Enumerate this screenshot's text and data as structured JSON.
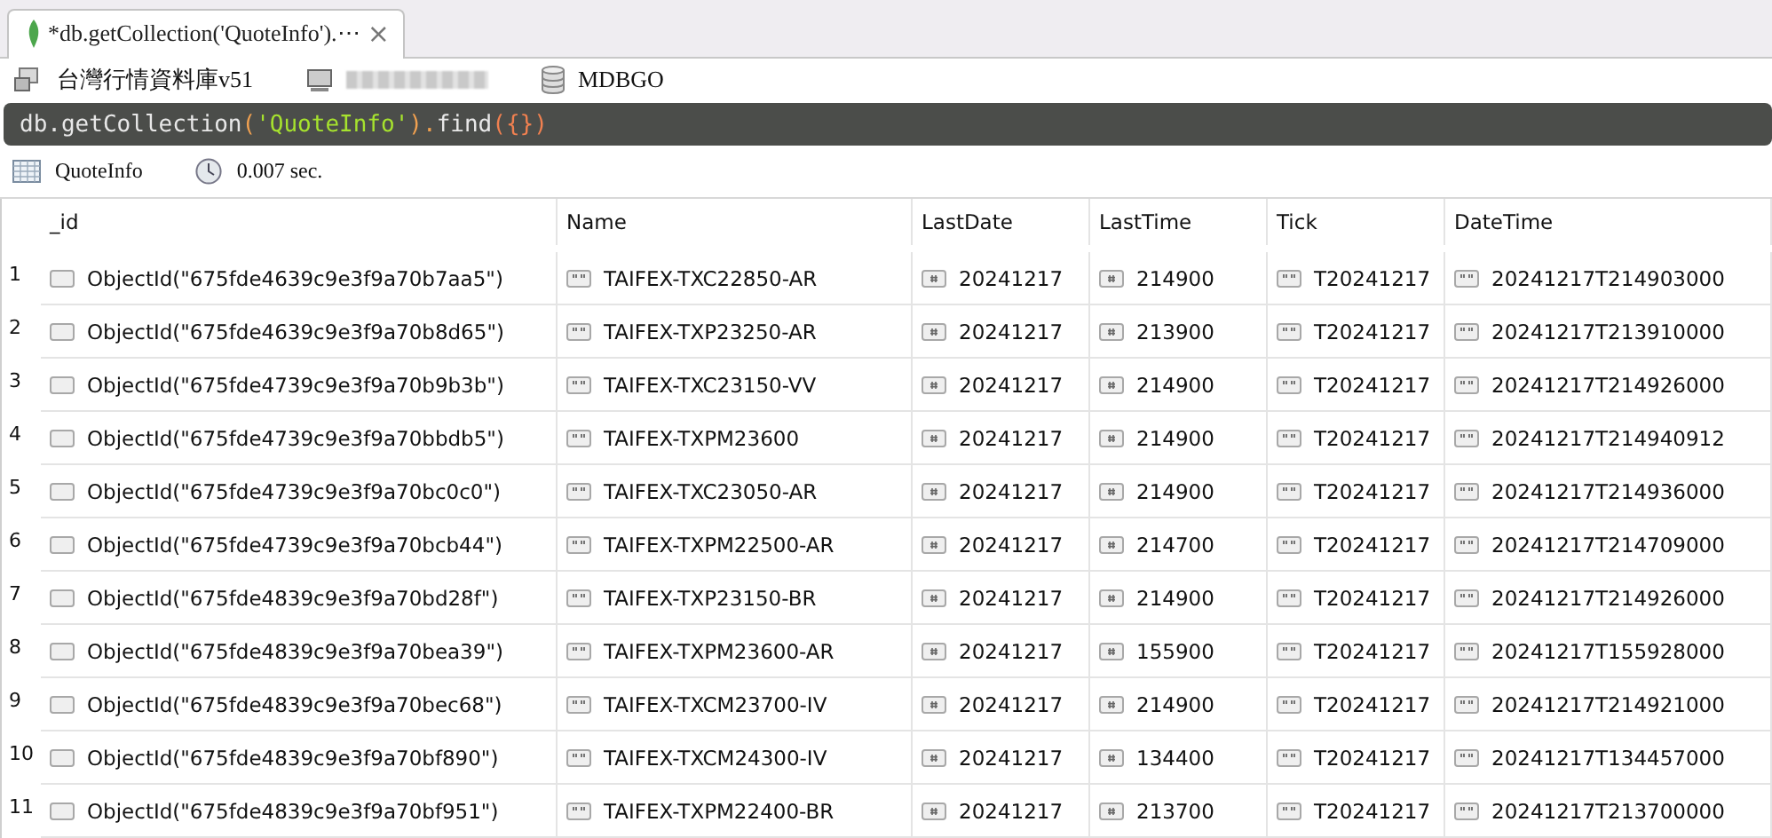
{
  "tab": {
    "title": "*db.getCollection('QuoteInfo').⋯",
    "close": "×",
    "selected": true
  },
  "connection": {
    "database": "台灣行情資料庫v51",
    "database_name": "MDBGO"
  },
  "query": {
    "tokens": [
      {
        "text": "db",
        "color": "#e8e8e8"
      },
      {
        "text": ".getCollection",
        "color": "#e8e8e8"
      },
      {
        "text": "(",
        "color": "#f0a050"
      },
      {
        "text": "'QuoteInfo'",
        "color": "#a6e22e"
      },
      {
        "text": ").",
        "color": "#f0a050"
      },
      {
        "text": "find",
        "color": "#e8e8e8"
      },
      {
        "text": "({})",
        "color": "#f08050"
      }
    ]
  },
  "result": {
    "collection": "QuoteInfo",
    "time": "0.007 sec."
  },
  "table": {
    "columns": [
      {
        "label": "_id",
        "kind": "objectid"
      },
      {
        "label": "Name",
        "kind": "string"
      },
      {
        "label": "LastDate",
        "kind": "number"
      },
      {
        "label": "LastTime",
        "kind": "number"
      },
      {
        "label": "Tick",
        "kind": "string"
      },
      {
        "label": "DateTime",
        "kind": "string"
      }
    ],
    "rows": [
      {
        "index": "1",
        "cells": [
          "ObjectId(\"675fde4639c9e3f9a70b7aa5\")",
          "TAIFEX-TXC22850-AR",
          "20241217",
          "214900",
          "T20241217",
          "20241217T214903000"
        ]
      },
      {
        "index": "2",
        "cells": [
          "ObjectId(\"675fde4639c9e3f9a70b8d65\")",
          "TAIFEX-TXP23250-AR",
          "20241217",
          "213900",
          "T20241217",
          "20241217T213910000"
        ]
      },
      {
        "index": "3",
        "cells": [
          "ObjectId(\"675fde4739c9e3f9a70b9b3b\")",
          "TAIFEX-TXC23150-VV",
          "20241217",
          "214900",
          "T20241217",
          "20241217T214926000"
        ]
      },
      {
        "index": "4",
        "cells": [
          "ObjectId(\"675fde4739c9e3f9a70bbdb5\")",
          "TAIFEX-TXPM23600",
          "20241217",
          "214900",
          "T20241217",
          "20241217T214940912"
        ]
      },
      {
        "index": "5",
        "cells": [
          "ObjectId(\"675fde4739c9e3f9a70bc0c0\")",
          "TAIFEX-TXC23050-AR",
          "20241217",
          "214900",
          "T20241217",
          "20241217T214936000"
        ]
      },
      {
        "index": "6",
        "cells": [
          "ObjectId(\"675fde4739c9e3f9a70bcb44\")",
          "TAIFEX-TXPM22500-AR",
          "20241217",
          "214700",
          "T20241217",
          "20241217T214709000"
        ]
      },
      {
        "index": "7",
        "cells": [
          "ObjectId(\"675fde4839c9e3f9a70bd28f\")",
          "TAIFEX-TXP23150-BR",
          "20241217",
          "214900",
          "T20241217",
          "20241217T214926000"
        ]
      },
      {
        "index": "8",
        "cells": [
          "ObjectId(\"675fde4839c9e3f9a70bea39\")",
          "TAIFEX-TXPM23600-AR",
          "20241217",
          "155900",
          "T20241217",
          "20241217T155928000"
        ]
      },
      {
        "index": "9",
        "cells": [
          "ObjectId(\"675fde4839c9e3f9a70bec68\")",
          "TAIFEX-TXCM23700-IV",
          "20241217",
          "214900",
          "T20241217",
          "20241217T214921000"
        ]
      },
      {
        "index": "10",
        "cells": [
          "ObjectId(\"675fde4839c9e3f9a70bf890\")",
          "TAIFEX-TXCM24300-IV",
          "20241217",
          "134400",
          "T20241217",
          "20241217T134457000"
        ]
      },
      {
        "index": "11",
        "cells": [
          "ObjectId(\"675fde4839c9e3f9a70bf951\")",
          "TAIFEX-TXPM22400-BR",
          "20241217",
          "213700",
          "T20241217",
          "20241217T213700000"
        ]
      }
    ]
  }
}
